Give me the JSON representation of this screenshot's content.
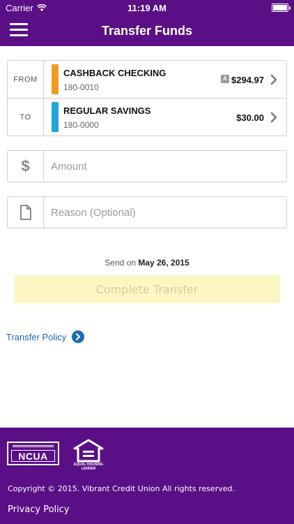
{
  "status_bar": {
    "carrier": "Carrier",
    "time": "11:19 AM"
  },
  "header": {
    "title": "Transfer Funds",
    "menu_icon": "hamburger-menu-icon"
  },
  "accounts": {
    "from": {
      "label": "FROM",
      "name": "CASHBACK CHECKING",
      "number": "180-0010",
      "badge": "A",
      "amount": "$294.97",
      "color": "#f39a1e"
    },
    "to": {
      "label": "TO",
      "name": "REGULAR SAVINGS",
      "number": "180-0000",
      "amount": "$30.00",
      "color": "#22a5de"
    }
  },
  "amount_field": {
    "symbol": "$",
    "placeholder": "Amount",
    "value": ""
  },
  "reason_field": {
    "icon": "document-icon",
    "placeholder": "Reason (Optional)",
    "value": ""
  },
  "send_on": {
    "prefix": "Send on",
    "date": "May 26, 2015"
  },
  "complete_button": {
    "label": "Complete Transfer",
    "enabled": false
  },
  "transfer_policy": {
    "label": "Transfer Policy",
    "icon": "chevron-right-circle-icon"
  },
  "footer": {
    "ncua_logo_text": "NCUA",
    "ehl_logo_text": "EQUAL HOUSING LENDER",
    "copyright": "Copyright © 2015. Vibrant Credit Union All rights reserved.",
    "privacy_link": "Privacy Policy"
  },
  "colors": {
    "brand_purple": "#5a0f86",
    "button_disabled_bg": "#fbf6c2",
    "link_blue": "#1f66a9"
  }
}
